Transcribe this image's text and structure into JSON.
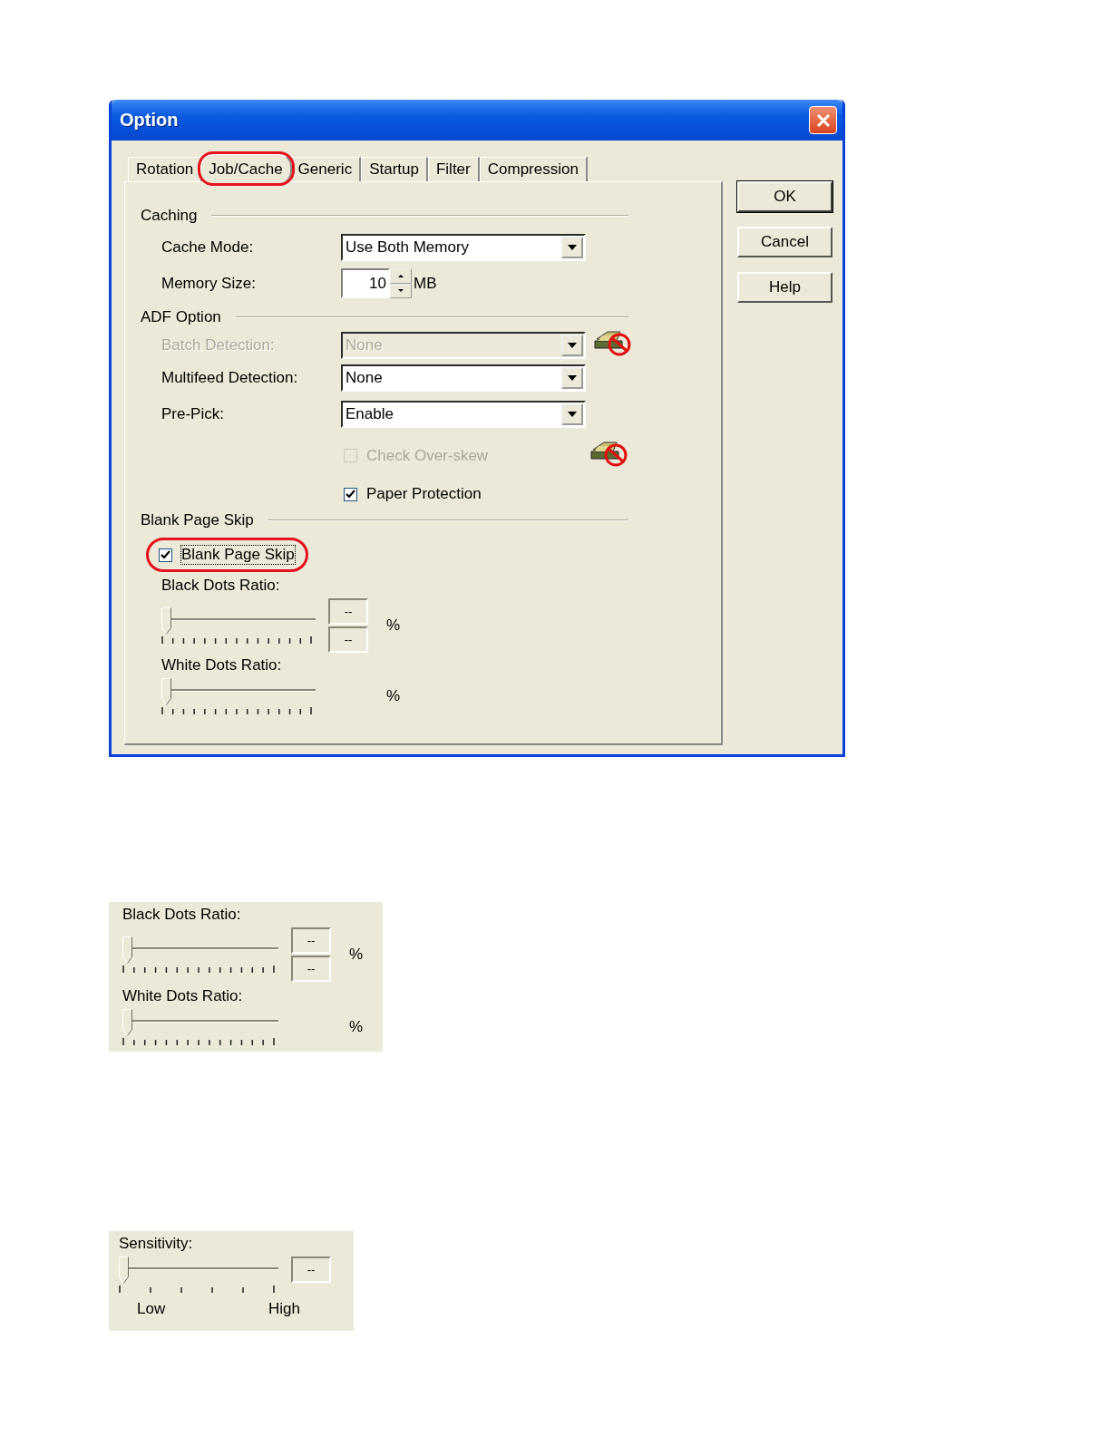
{
  "window": {
    "title": "Option"
  },
  "tabs": [
    {
      "label": "Rotation",
      "selected": false,
      "highlighted": false
    },
    {
      "label": "Job/Cache",
      "selected": true,
      "highlighted": true
    },
    {
      "label": "Generic",
      "selected": false,
      "highlighted": false
    },
    {
      "label": "Startup",
      "selected": false,
      "highlighted": false
    },
    {
      "label": "Filter",
      "selected": false,
      "highlighted": false
    },
    {
      "label": "Compression",
      "selected": false,
      "highlighted": false
    }
  ],
  "sections": [
    {
      "title": "Caching",
      "rows": [
        {
          "kind": "dropdown",
          "label": "Cache Mode:",
          "value": "Use Both Memory",
          "disabled": false,
          "unsupported": false
        },
        {
          "kind": "spinner",
          "label": "Memory Size:",
          "value": "10",
          "unit": "MB"
        }
      ]
    },
    {
      "title": "ADF Option",
      "rows": [
        {
          "kind": "dropdown",
          "label": "Batch Detection:",
          "value": "None",
          "disabled": true,
          "unsupported": true
        },
        {
          "kind": "dropdown",
          "label": "Multifeed Detection:",
          "value": "None",
          "disabled": false,
          "unsupported": false
        },
        {
          "kind": "dropdown",
          "label": "Pre-Pick:",
          "value": "Enable",
          "disabled": false,
          "unsupported": false
        },
        {
          "kind": "checkbox",
          "label": "Check Over-skew",
          "checked": false,
          "disabled": true,
          "unsupported": true,
          "focused": false,
          "highlighted": false
        },
        {
          "kind": "checkbox",
          "label": "Paper Protection",
          "checked": true,
          "disabled": false,
          "unsupported": false,
          "focused": false,
          "highlighted": false
        }
      ]
    },
    {
      "title": "Blank Page Skip",
      "rows": [
        {
          "kind": "option",
          "label": "Blank Page Skip",
          "checked": true,
          "disabled": false,
          "focused": true,
          "highlighted": true
        },
        {
          "kind": "slider",
          "label": "Black Dots Ratio:",
          "level": 0,
          "readings": [
            "--",
            "--"
          ],
          "unit": "%"
        },
        {
          "kind": "slider",
          "label": "White Dots Ratio:",
          "level": 0,
          "unit": "%"
        }
      ]
    }
  ],
  "buttons": [
    {
      "label": "OK",
      "default": true
    },
    {
      "label": "Cancel",
      "default": false
    },
    {
      "label": "Help",
      "default": false
    }
  ],
  "excerpts": [
    {
      "kind": "ratios",
      "rows": [
        {
          "kind": "slider",
          "label": "Black Dots Ratio:",
          "level": 0,
          "readings": [
            "--",
            "--"
          ],
          "unit": "%"
        },
        {
          "kind": "slider",
          "label": "White Dots Ratio:",
          "level": 0,
          "unit": "%"
        }
      ]
    },
    {
      "kind": "sensitivity",
      "label": "Sensitivity:",
      "level": 0,
      "reading": "--",
      "low": "Low",
      "high": "High"
    }
  ]
}
